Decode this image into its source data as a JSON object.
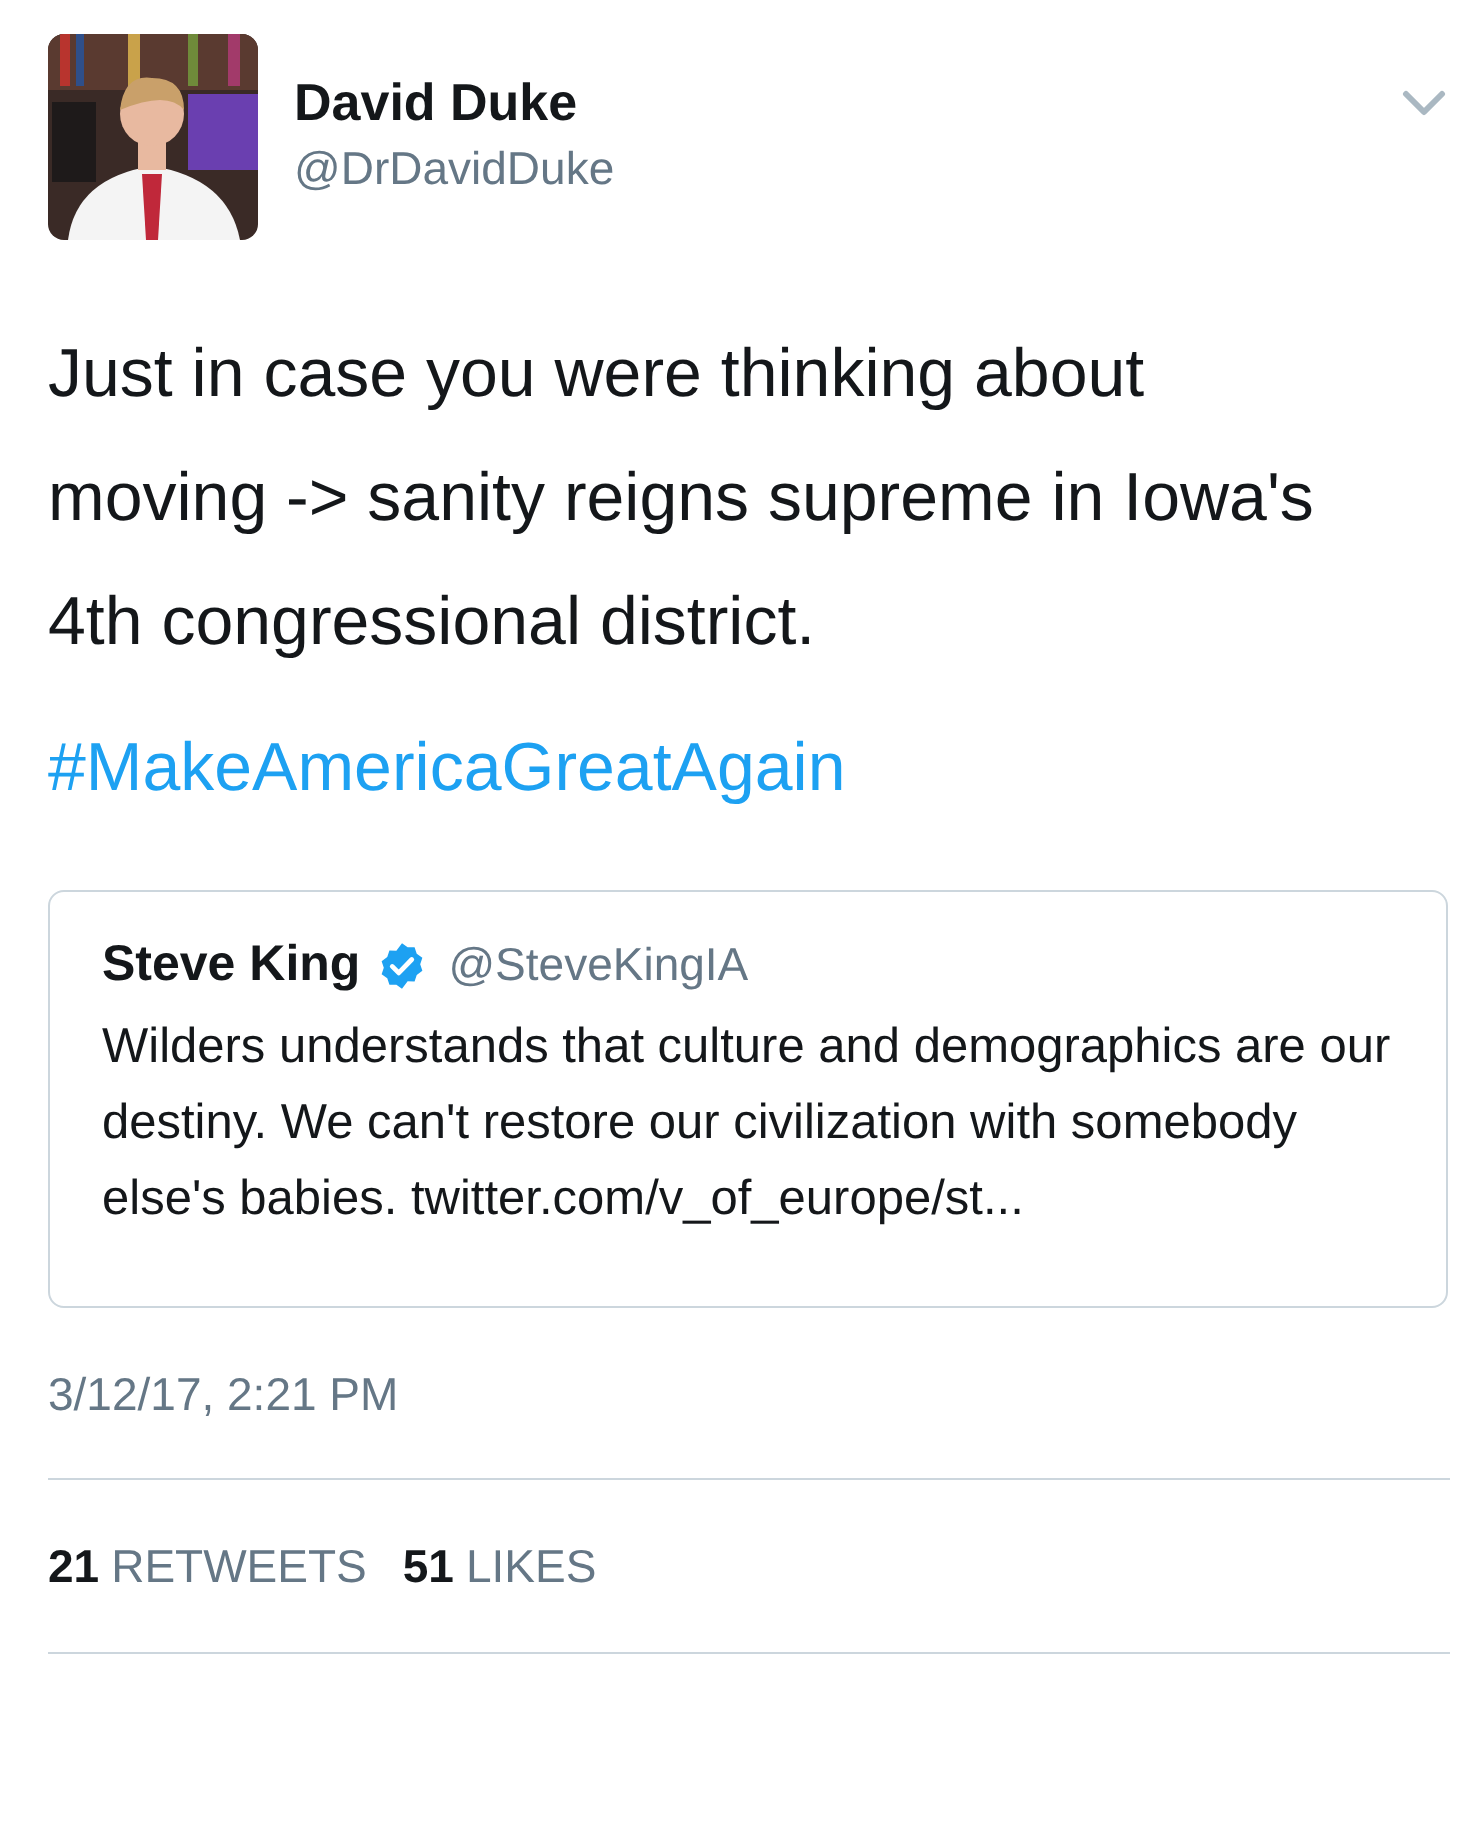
{
  "tweet": {
    "author": {
      "name": "David Duke",
      "handle": "@DrDavidDuke"
    },
    "text": "Just in case you were thinking about moving -> sanity reigns supreme in Iowa's 4th congressional district.",
    "hashtag": "#MakeAmericaGreatAgain",
    "quoted": {
      "name": "Steve King",
      "verified": true,
      "handle": "@SteveKingIA",
      "text": "Wilders understands that culture and demographics are our destiny. We can't restore our civilization with somebody else's babies. twitter.com/v_of_europe/st..."
    },
    "timestamp": "3/12/17, 2:21 PM",
    "stats": [
      {
        "count": "21",
        "label": "RETWEETS"
      },
      {
        "count": "51",
        "label": "LIKES"
      }
    ]
  }
}
